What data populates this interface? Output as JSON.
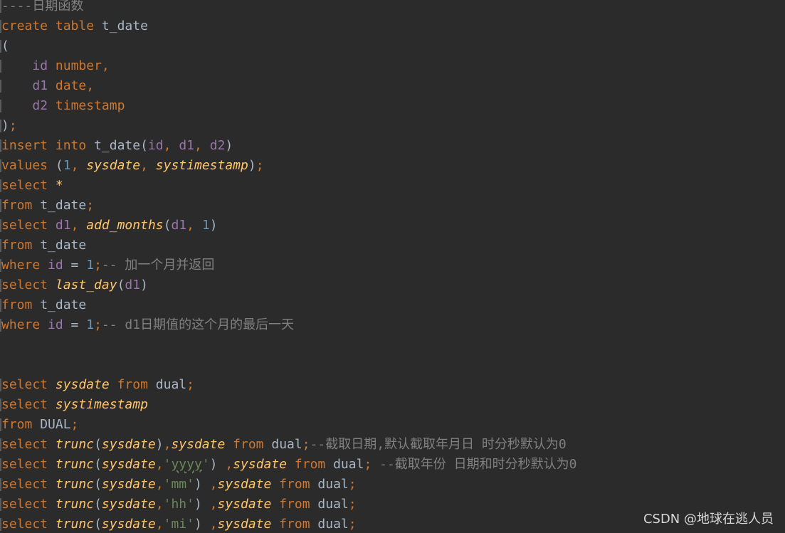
{
  "editor": {
    "language": "sql",
    "colors": {
      "background": "#2b2b2b",
      "keyword": "#cc7832",
      "function": "#ffc66d",
      "column": "#9876aa",
      "number": "#6897bb",
      "string": "#6a8759",
      "comment": "#808080",
      "text": "#a9b7c6"
    },
    "lines": [
      [
        {
          "t": "----日期函数",
          "c": "cmt"
        }
      ],
      [
        {
          "t": "create",
          "c": "kw"
        },
        {
          "t": " "
        },
        {
          "t": "table",
          "c": "kw"
        },
        {
          "t": " t_date"
        }
      ],
      [
        {
          "t": "("
        }
      ],
      [
        {
          "t": "    "
        },
        {
          "t": "id",
          "c": "col"
        },
        {
          "t": " "
        },
        {
          "t": "number,",
          "c": "kw"
        }
      ],
      [
        {
          "t": "    "
        },
        {
          "t": "d1",
          "c": "col"
        },
        {
          "t": " "
        },
        {
          "t": "date,",
          "c": "kw"
        }
      ],
      [
        {
          "t": "    "
        },
        {
          "t": "d2",
          "c": "col"
        },
        {
          "t": " "
        },
        {
          "t": "timestamp",
          "c": "kw"
        }
      ],
      [
        {
          "t": ")"
        },
        {
          "t": ";",
          "c": "kw"
        }
      ],
      [
        {
          "t": "insert",
          "c": "kw"
        },
        {
          "t": " "
        },
        {
          "t": "into",
          "c": "kw"
        },
        {
          "t": " t_date("
        },
        {
          "t": "id",
          "c": "col"
        },
        {
          "t": ", ",
          "c": "kw"
        },
        {
          "t": "d1",
          "c": "col"
        },
        {
          "t": ", ",
          "c": "kw"
        },
        {
          "t": "d2",
          "c": "col"
        },
        {
          "t": ")"
        }
      ],
      [
        {
          "t": "values",
          "c": "kw"
        },
        {
          "t": " ("
        },
        {
          "t": "1",
          "c": "num"
        },
        {
          "t": ", ",
          "c": "kw"
        },
        {
          "t": "sysdate",
          "c": "fn"
        },
        {
          "t": ", ",
          "c": "kw"
        },
        {
          "t": "systimestamp",
          "c": "fn"
        },
        {
          "t": ")"
        },
        {
          "t": ";",
          "c": "kw"
        }
      ],
      [
        {
          "t": "select",
          "c": "kw"
        },
        {
          "t": " "
        },
        {
          "t": "*",
          "c": "fn"
        }
      ],
      [
        {
          "t": "from",
          "c": "kw"
        },
        {
          "t": " t_date"
        },
        {
          "t": ";",
          "c": "kw"
        }
      ],
      [
        {
          "t": "select",
          "c": "kw"
        },
        {
          "t": " "
        },
        {
          "t": "d1",
          "c": "col"
        },
        {
          "t": ", ",
          "c": "kw"
        },
        {
          "t": "add_months",
          "c": "fn"
        },
        {
          "t": "("
        },
        {
          "t": "d1",
          "c": "col"
        },
        {
          "t": ", ",
          "c": "kw"
        },
        {
          "t": "1",
          "c": "num"
        },
        {
          "t": ")"
        }
      ],
      [
        {
          "t": "from",
          "c": "kw"
        },
        {
          "t": " t_date"
        }
      ],
      [
        {
          "t": "where",
          "c": "kw"
        },
        {
          "t": " "
        },
        {
          "t": "id",
          "c": "col"
        },
        {
          "t": " = "
        },
        {
          "t": "1",
          "c": "num"
        },
        {
          "t": ";",
          "c": "kw"
        },
        {
          "t": "-- 加一个月并返回",
          "c": "cmt"
        }
      ],
      [
        {
          "t": "select",
          "c": "kw"
        },
        {
          "t": " "
        },
        {
          "t": "last_day",
          "c": "fn"
        },
        {
          "t": "("
        },
        {
          "t": "d1",
          "c": "col"
        },
        {
          "t": ")"
        }
      ],
      [
        {
          "t": "from",
          "c": "kw"
        },
        {
          "t": " t_date"
        }
      ],
      [
        {
          "t": "where",
          "c": "kw"
        },
        {
          "t": " "
        },
        {
          "t": "id",
          "c": "col"
        },
        {
          "t": " = "
        },
        {
          "t": "1",
          "c": "num"
        },
        {
          "t": ";",
          "c": "kw"
        },
        {
          "t": "-- d1日期值的这个月的最后一天",
          "c": "cmt"
        }
      ],
      [],
      [],
      [
        {
          "t": "select",
          "c": "kw"
        },
        {
          "t": " "
        },
        {
          "t": "sysdate",
          "c": "fn"
        },
        {
          "t": " "
        },
        {
          "t": "from",
          "c": "kw"
        },
        {
          "t": " dual"
        },
        {
          "t": ";",
          "c": "kw"
        }
      ],
      [
        {
          "t": "select",
          "c": "kw"
        },
        {
          "t": " "
        },
        {
          "t": "systimestamp",
          "c": "fn"
        }
      ],
      [
        {
          "t": "from",
          "c": "kw"
        },
        {
          "t": " DUAL"
        },
        {
          "t": ";",
          "c": "kw"
        }
      ],
      [
        {
          "t": "select",
          "c": "kw"
        },
        {
          "t": " "
        },
        {
          "t": "trunc",
          "c": "fn"
        },
        {
          "t": "("
        },
        {
          "t": "sysdate",
          "c": "fn"
        },
        {
          "t": ")"
        },
        {
          "t": ",",
          "c": "kw"
        },
        {
          "t": "sysdate",
          "c": "fn"
        },
        {
          "t": " "
        },
        {
          "t": "from",
          "c": "kw"
        },
        {
          "t": " dual"
        },
        {
          "t": ";",
          "c": "kw"
        },
        {
          "t": "--截取日期,默认截取年月日 时分秒默认为0",
          "c": "cmt"
        }
      ],
      [
        {
          "t": "select",
          "c": "kw"
        },
        {
          "t": " "
        },
        {
          "t": "trunc",
          "c": "fn"
        },
        {
          "t": "("
        },
        {
          "t": "sysdate",
          "c": "fn"
        },
        {
          "t": ",",
          "c": "kw"
        },
        {
          "t": "'",
          "c": "str"
        },
        {
          "t": "yyyy",
          "c": "str-warn"
        },
        {
          "t": "'",
          "c": "str"
        },
        {
          "t": ") "
        },
        {
          "t": ",",
          "c": "kw"
        },
        {
          "t": "sysdate",
          "c": "fn"
        },
        {
          "t": " "
        },
        {
          "t": "from",
          "c": "kw"
        },
        {
          "t": " dual"
        },
        {
          "t": ";",
          "c": "kw"
        },
        {
          "t": " --截取年份 日期和时分秒默认为0",
          "c": "cmt"
        }
      ],
      [
        {
          "t": "select",
          "c": "kw"
        },
        {
          "t": " "
        },
        {
          "t": "trunc",
          "c": "fn"
        },
        {
          "t": "("
        },
        {
          "t": "sysdate",
          "c": "fn"
        },
        {
          "t": ",",
          "c": "kw"
        },
        {
          "t": "'mm'",
          "c": "str"
        },
        {
          "t": ") "
        },
        {
          "t": ",",
          "c": "kw"
        },
        {
          "t": "sysdate",
          "c": "fn"
        },
        {
          "t": " "
        },
        {
          "t": "from",
          "c": "kw"
        },
        {
          "t": " dual"
        },
        {
          "t": ";",
          "c": "kw"
        }
      ],
      [
        {
          "t": "select",
          "c": "kw"
        },
        {
          "t": " "
        },
        {
          "t": "trunc",
          "c": "fn"
        },
        {
          "t": "("
        },
        {
          "t": "sysdate",
          "c": "fn"
        },
        {
          "t": ",",
          "c": "kw"
        },
        {
          "t": "'hh'",
          "c": "str"
        },
        {
          "t": ") "
        },
        {
          "t": ",",
          "c": "kw"
        },
        {
          "t": "sysdate",
          "c": "fn"
        },
        {
          "t": " "
        },
        {
          "t": "from",
          "c": "kw"
        },
        {
          "t": " dual"
        },
        {
          "t": ";",
          "c": "kw"
        }
      ],
      [
        {
          "t": "select",
          "c": "kw"
        },
        {
          "t": " "
        },
        {
          "t": "trunc",
          "c": "fn"
        },
        {
          "t": "("
        },
        {
          "t": "sysdate",
          "c": "fn"
        },
        {
          "t": ",",
          "c": "kw"
        },
        {
          "t": "'mi'",
          "c": "str"
        },
        {
          "t": ") "
        },
        {
          "t": ",",
          "c": "kw"
        },
        {
          "t": "sysdate",
          "c": "fn"
        },
        {
          "t": " "
        },
        {
          "t": "from",
          "c": "kw"
        },
        {
          "t": " dual"
        },
        {
          "t": ";",
          "c": "kw"
        }
      ]
    ]
  },
  "watermark": {
    "text": "CSDN @地球在逃人员"
  }
}
